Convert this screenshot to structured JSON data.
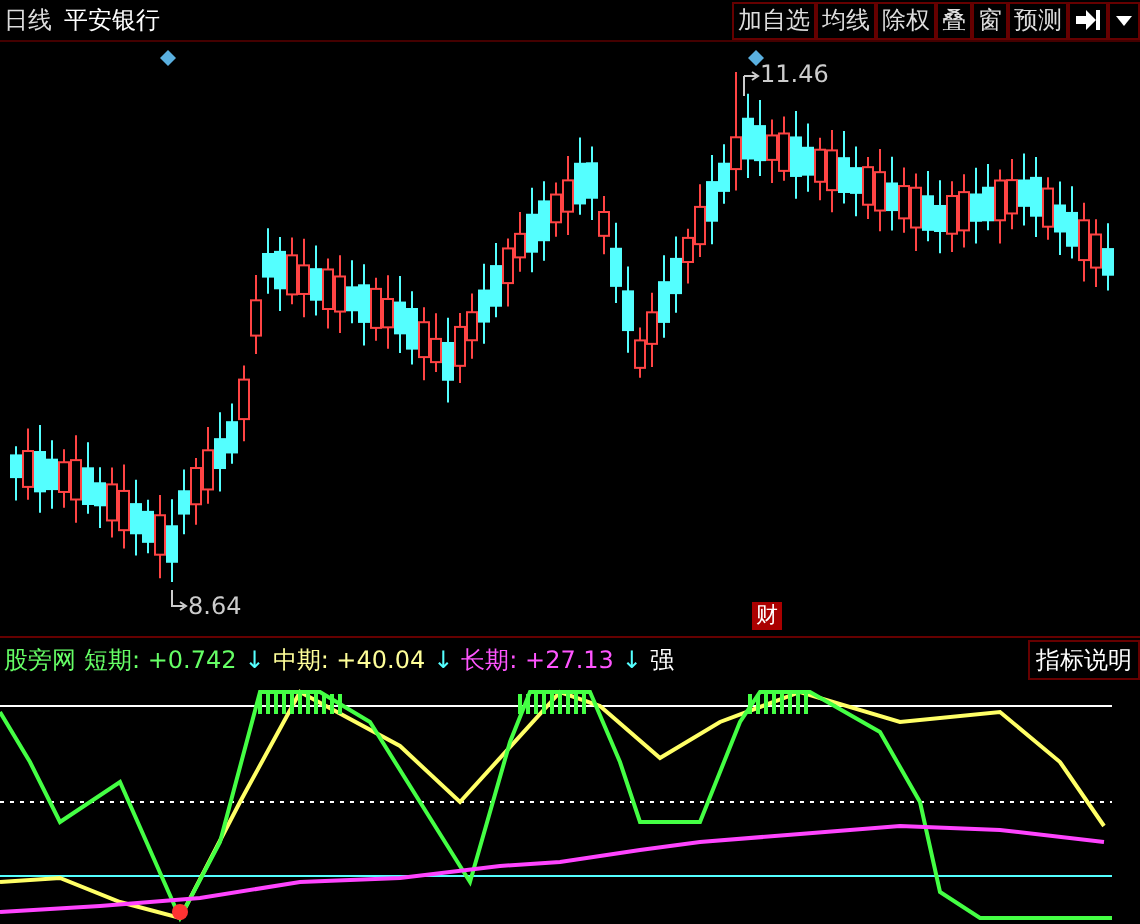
{
  "toolbar": {
    "period": "日线",
    "stock_name": "平安银行",
    "buttons": [
      "加自选",
      "均线",
      "除权",
      "叠",
      "窗",
      "预测"
    ]
  },
  "main_chart": {
    "high_label": "11.46",
    "low_label": "8.64",
    "event_marker": "财"
  },
  "indicator": {
    "items": [
      {
        "text": "股旁网",
        "color": "#66ff66"
      },
      {
        "text": "短期: +0.742",
        "arrow": "↓",
        "color": "#66ff66"
      },
      {
        "text": "中期: +40.04",
        "arrow": "↓",
        "color": "#ffff99"
      },
      {
        "text": "长期: +27.13",
        "arrow": "↓",
        "color": "#ff55ff"
      },
      {
        "text": "强",
        "color": "#ffffff"
      }
    ],
    "help_button": "指标说明"
  }
}
